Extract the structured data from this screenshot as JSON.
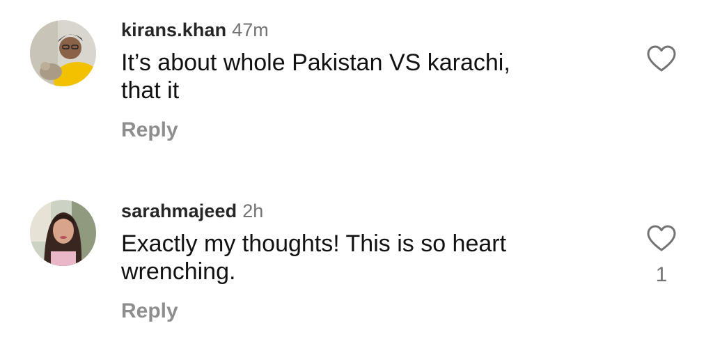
{
  "comments": [
    {
      "username": "kirans.khan",
      "time": "47m",
      "text": "It’s about whole Pakistan VS karachi,\nthat it",
      "reply_label": "Reply",
      "like_count": ""
    },
    {
      "username": "sarahmajeed",
      "time": "2h",
      "text": "Exactly my thoughts! This is so heart\nwrenching.",
      "reply_label": "Reply",
      "like_count": "1"
    }
  ],
  "icons": {
    "like": "heart-outline-icon"
  },
  "colors": {
    "username": "#262626",
    "secondary": "#737373",
    "reply": "#8e8e8e"
  }
}
